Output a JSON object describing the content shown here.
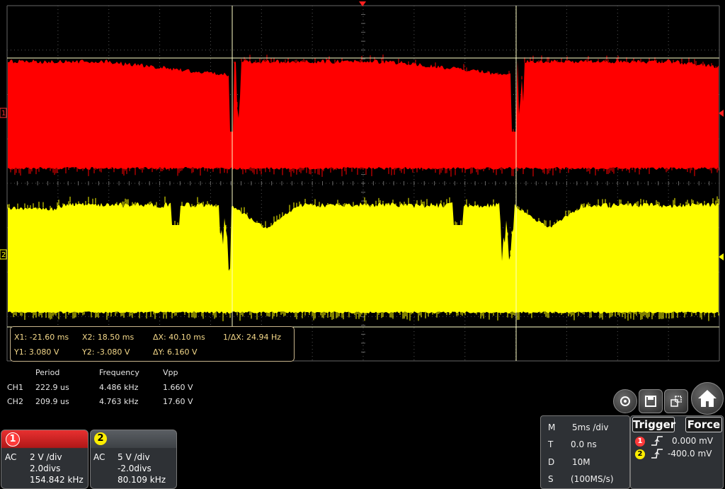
{
  "cursors": {
    "x1": "X1: -21.60 ms",
    "x2": "X2: 18.50 ms",
    "dx": "ΔX: 40.10 ms",
    "inv_dx": "1/ΔX: 24.94 Hz",
    "y1": "Y1: 3.080 V",
    "y2": "Y2: -3.080 V",
    "dy": "ΔY: 6.160 V"
  },
  "measurements": {
    "headers": [
      "Period",
      "Frequency",
      "Vpp"
    ],
    "rows": [
      {
        "ch": "CH1",
        "period": "222.9 us",
        "frequency": "4.486 kHz",
        "vpp": "1.660 V"
      },
      {
        "ch": "CH2",
        "period": "209.9 us",
        "frequency": "4.763 kHz",
        "vpp": "17.60 V"
      }
    ]
  },
  "channels": [
    {
      "num": "1",
      "coupling": "AC",
      "scale": "2 V /div",
      "offset": "2.0divs",
      "freq": "154.842 kHz",
      "color": "#ff0000"
    },
    {
      "num": "2",
      "coupling": "AC",
      "scale": "5 V /div",
      "offset": "-2.0divs",
      "freq": "80.109 kHz",
      "color": "#ffff00"
    }
  ],
  "waveform_markers": {
    "ch1": "1",
    "ch2": "2"
  },
  "timebase": {
    "m_label": "M",
    "m_value": "5ms /div",
    "t_label": "T",
    "t_value": "0.0 ns",
    "d_label": "D",
    "d_value": "10M",
    "s_label": "S",
    "s_value": "(100MS/s)"
  },
  "trigger": {
    "trigger_label": "Trigger",
    "force_label": "Force",
    "ch1_num": "1",
    "ch1_level": "0.000 mV",
    "ch2_num": "2",
    "ch2_level": "-400.0 mV"
  },
  "toolbar_icons": [
    "home-settings-icon",
    "save-icon",
    "window-swap-icon",
    "home-icon"
  ],
  "colors": {
    "ch1": "#ff0000",
    "ch2": "#ffff00",
    "grid": "#555555",
    "cursor": "#ffffc8"
  }
}
